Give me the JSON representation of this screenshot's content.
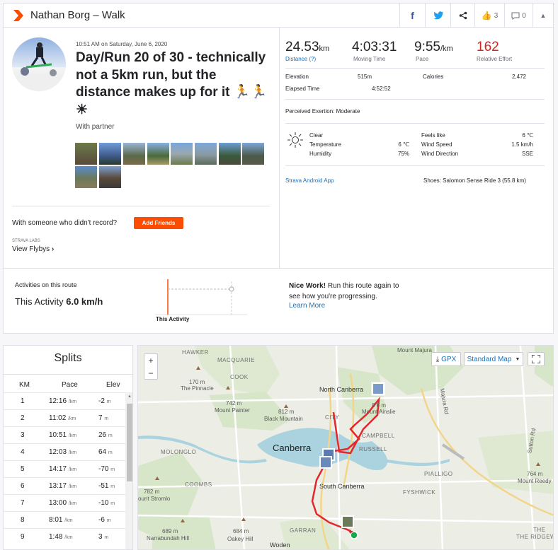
{
  "header": {
    "title": "Nathan Borg – Walk",
    "kudos_count": "3",
    "comments_count": "0"
  },
  "activity": {
    "datetime": "10:51 AM on Saturday, June 6, 2020",
    "title": "Day/Run 20 of 30 - technically not a 5km run, but the distance makes up for it 🏃🏃☀",
    "with": "With partner"
  },
  "stats": {
    "distance_value": "24.53",
    "distance_unit": "km",
    "distance_label": "Distance (?)",
    "moving_time_value": "4:03:31",
    "moving_time_label": "Moving Time",
    "pace_value": "9:55",
    "pace_unit": "/km",
    "pace_label": "Pace",
    "relative_effort_value": "162",
    "relative_effort_label": "Relative Effort",
    "elevation_label": "Elevation",
    "elevation_value": "515m",
    "calories_label": "Calories",
    "calories_value": "2,472",
    "elapsed_label": "Elapsed Time",
    "elapsed_value": "4:52:52",
    "exertion": "Perceived Exertion: Moderate"
  },
  "weather": {
    "condition": "Clear",
    "temperature_label": "Temperature",
    "temperature_value": "6 ℃",
    "humidity_label": "Humidity",
    "humidity_value": "75%",
    "feels_like_label": "Feels like",
    "feels_like_value": "6 ℃",
    "wind_speed_label": "Wind Speed",
    "wind_speed_value": "1.5 km/h",
    "wind_direction_label": "Wind Direction",
    "wind_direction_value": "SSE"
  },
  "device": "Strava Android App",
  "shoes": "Shoes: Salomon Sense Ride 3 (55.8 km)",
  "friends": {
    "prompt": "With someone who didn't record?",
    "button": "Add Friends"
  },
  "flyby": {
    "labs": "STRAVA LABS",
    "link": "View Flybys"
  },
  "route": {
    "heading": "Activities on this route",
    "this_activity_label": "This Activity",
    "this_activity_value": "6.0 km/h",
    "chart_label": "This Activity",
    "nice_bold": "Nice Work!",
    "nice_text": " Run this route again to see how you're progressing.",
    "learn_more": "Learn More"
  },
  "splits": {
    "title": "Splits",
    "col_km": "KM",
    "col_pace": "Pace",
    "col_elev": "Elev",
    "rows": [
      {
        "km": "1",
        "pace": "12:16",
        "elev": "-2"
      },
      {
        "km": "2",
        "pace": "11:02",
        "elev": "7"
      },
      {
        "km": "3",
        "pace": "10:51",
        "elev": "26"
      },
      {
        "km": "4",
        "pace": "12:03",
        "elev": "64"
      },
      {
        "km": "5",
        "pace": "14:17",
        "elev": "-70"
      },
      {
        "km": "6",
        "pace": "13:17",
        "elev": "-51"
      },
      {
        "km": "7",
        "pace": "13:00",
        "elev": "-10"
      },
      {
        "km": "8",
        "pace": "8:01",
        "elev": "-6"
      },
      {
        "km": "9",
        "pace": "1:48",
        "elev": "3"
      }
    ],
    "pace_unit": "/km",
    "elev_unit": "m"
  },
  "map": {
    "gpx": "GPX",
    "map_type": "Standard Map",
    "labels": {
      "hawker": "HAWKER",
      "macquarie": "MACQUARIE",
      "cook": "COOK",
      "the_pinnacle": "The Pinnacle",
      "pinnacle_elev": "170 m",
      "mount_painter": "Mount Painter",
      "painter_elev": "742 m",
      "black_mountain": "Black Mountain",
      "black_elev": "812 m",
      "north_canberra": "North Canberra",
      "mount_ainslie": "Mount Ainslie",
      "ainslie_elev": "8 6 m",
      "mount_majura": "Mount Majura",
      "canberra": "Canberra",
      "campbell": "CAMPBELL",
      "russell": "RUSSELL",
      "city": "CITY",
      "molonglo": "MOLONGLO",
      "coombs": "COOMBS",
      "south_canberra": "South Canberra",
      "pialligo": "PIALLIGO",
      "fyshwick": "FYSHWICK",
      "stromlo_elev": "782 m",
      "stromlo": "ount Stromlo",
      "narrabundah": "Narrabundah Hill",
      "narrabundah_elev": "689 m",
      "oakey": "Oakey Hill",
      "oakey_elev": "684 m",
      "garran": "GARRAN",
      "woden": "Woden",
      "mount_reedy": "Mount Reedy",
      "reedy_elev": "764 m",
      "ridgeway": "THE RIDGEWAY",
      "majura_rd": "Majura Rd",
      "sutton_rd": "Sutton Rd",
      "the": "THE"
    }
  }
}
